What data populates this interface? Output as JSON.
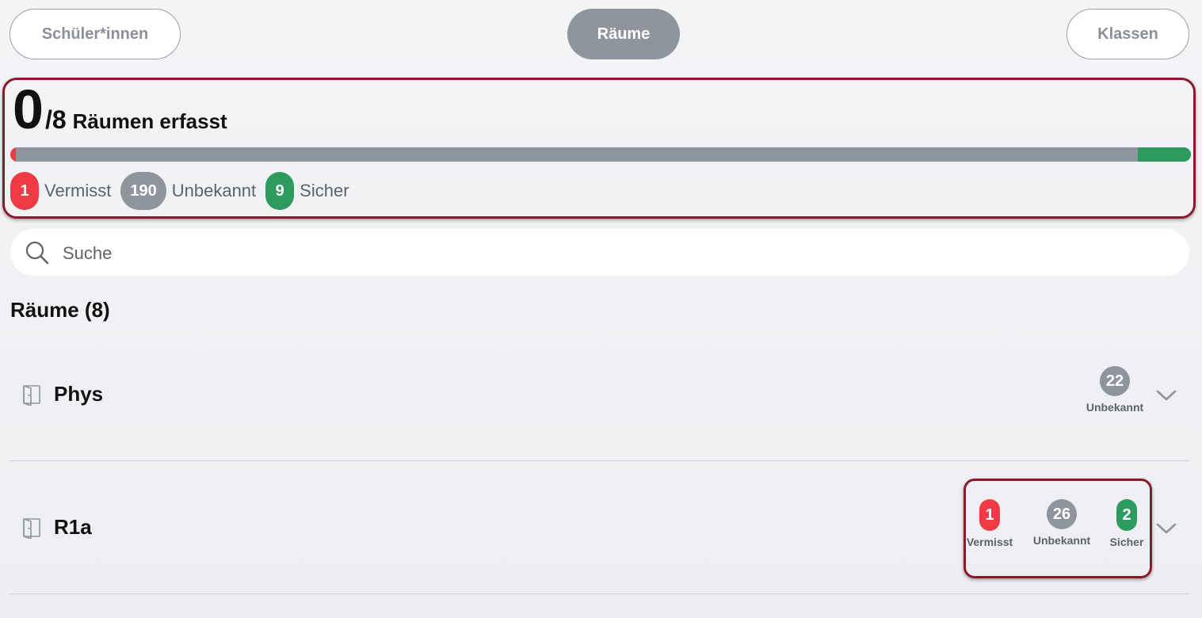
{
  "tabs": [
    {
      "label": "Schüler*innen",
      "active": false
    },
    {
      "label": "Räume",
      "active": true
    },
    {
      "label": "Klassen",
      "active": false
    }
  ],
  "summary": {
    "captured": "0",
    "total": "/8",
    "label": "Räumen erfasst",
    "progress": {
      "missing_fraction": 0.005,
      "unknown_fraction": 0.95,
      "safe_fraction": 0.045
    },
    "legend": [
      {
        "count": "1",
        "label": "Vermisst",
        "color": "#f13a45"
      },
      {
        "count": "190",
        "label": "Unbekannt",
        "color": "#8e959d"
      },
      {
        "count": "9",
        "label": "Sicher",
        "color": "#2e9b5e"
      }
    ]
  },
  "search": {
    "placeholder": "Suche",
    "value": "",
    "icon": "search-icon"
  },
  "rooms_section": {
    "title": "Räume (8)",
    "rooms": [
      {
        "name": "Phys",
        "icon": "door-icon",
        "stats": [
          {
            "count": "22",
            "label": "Unbekannt",
            "color": "#8e959d"
          }
        ]
      },
      {
        "name": "R1a",
        "icon": "door-icon",
        "stats": [
          {
            "count": "1",
            "label": "Vermisst",
            "color": "#f13a45"
          },
          {
            "count": "26",
            "label": "Unbekannt",
            "color": "#8e959d"
          },
          {
            "count": "2",
            "label": "Sicher",
            "color": "#2e9b5e"
          }
        ]
      }
    ]
  },
  "colors": {
    "missing": "#f13a45",
    "unknown": "#8e959d",
    "safe": "#2e9b5e",
    "highlight_border": "#8a1a2a"
  }
}
